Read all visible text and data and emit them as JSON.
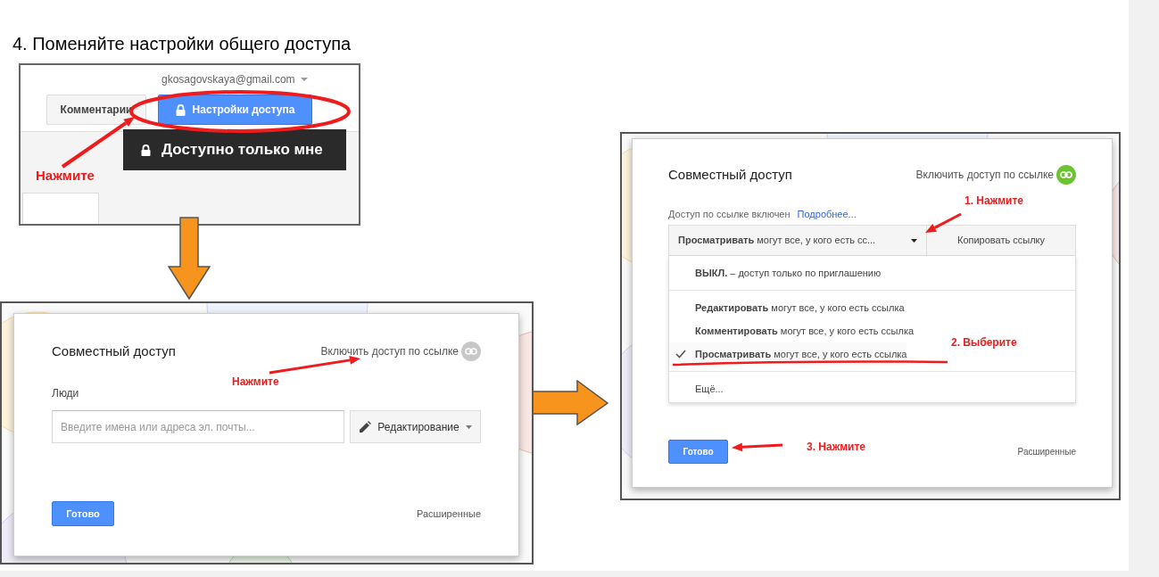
{
  "heading": "4. Поменяйте настройки общего доступа",
  "step1": {
    "account": "gkosagovskaya@gmail.com",
    "comments_button": "Комментарии",
    "share_button": "Настройки доступа",
    "tooltip": "Доступно только мне",
    "annotation": "Нажмите"
  },
  "step2": {
    "title": "Совместный доступ",
    "link_toggle": {
      "label": "Включить доступ по ссылке",
      "on": false
    },
    "annotation": "Нажмите",
    "people_label": "Люди",
    "people_field": {
      "placeholder": "Введите имена или адреса эл. почты..."
    },
    "permission_button": "Редактирование",
    "done_button": "Готово",
    "advanced_link": "Расширенные"
  },
  "step3": {
    "title": "Совместный доступ",
    "link_toggle": {
      "label": "Включить доступ по ссылке",
      "on": true
    },
    "link_status": "Доступ по ссылке включен",
    "more_link": "Подробнее...",
    "access_dropdown": "**Просматривать** могут все, у кого есть сс...",
    "copy_button": "Копировать ссылку",
    "options": [
      {
        "kind": "option",
        "text": "**ВЫКЛ.** – доступ только по приглашению",
        "selected": false
      },
      {
        "kind": "divider"
      },
      {
        "kind": "option",
        "text": "**Редактировать** могут все, у кого есть ссылка",
        "selected": false
      },
      {
        "kind": "option",
        "text": "**Комментировать** могут все, у кого есть ссылка",
        "selected": false
      },
      {
        "kind": "option",
        "text": "**Просматривать** могут все, у кого есть ссылка",
        "selected": true
      },
      {
        "kind": "divider"
      },
      {
        "kind": "option",
        "text": "Ещё...",
        "selected": false
      }
    ],
    "annotations": [
      "1. Нажмите",
      "2. Выберите",
      "3. Нажмите"
    ],
    "done_button": "Готово",
    "advanced_link": "Расширенные"
  }
}
